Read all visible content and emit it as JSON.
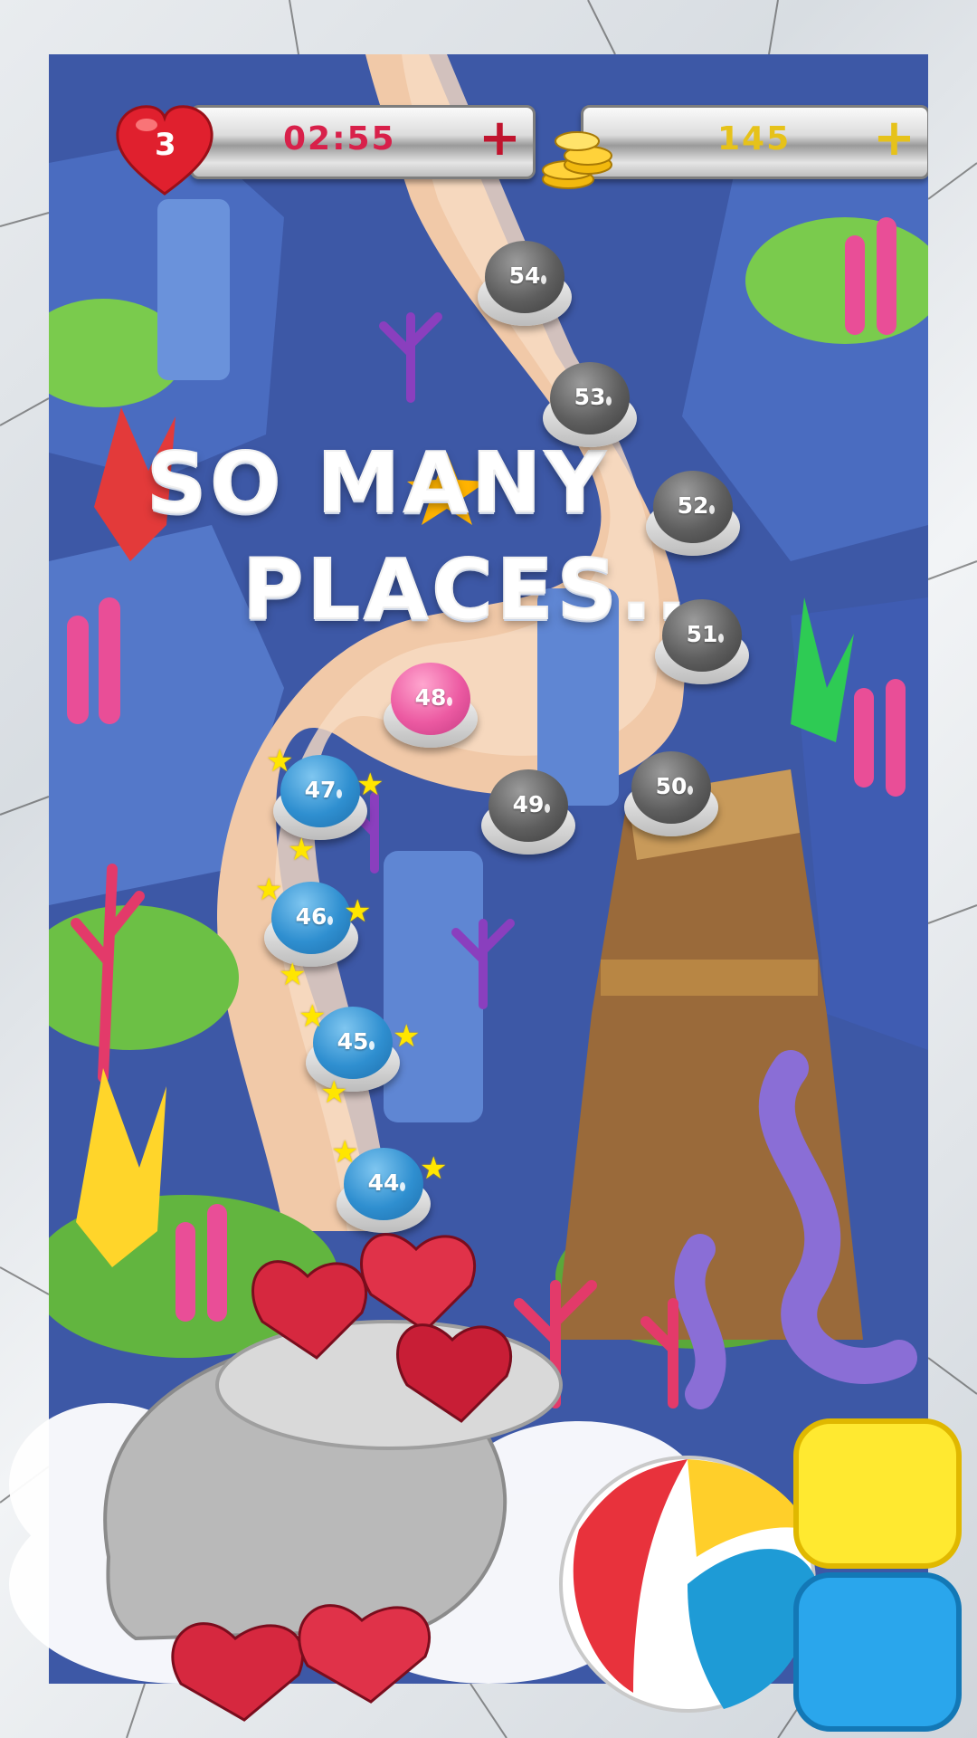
{
  "hud": {
    "lives_count": "3",
    "timer": "02:55",
    "timer_plus": "+",
    "coins": "145",
    "coins_plus": "+"
  },
  "title": {
    "line1": "SO MANY",
    "line2": "PLACES..."
  },
  "levels": [
    {
      "number": "54",
      "state": "locked"
    },
    {
      "number": "53",
      "state": "locked"
    },
    {
      "number": "52",
      "state": "locked"
    },
    {
      "number": "51",
      "state": "locked"
    },
    {
      "number": "50",
      "state": "locked"
    },
    {
      "number": "49",
      "state": "locked"
    },
    {
      "number": "48",
      "state": "current"
    },
    {
      "number": "47",
      "state": "completed"
    },
    {
      "number": "46",
      "state": "completed"
    },
    {
      "number": "45",
      "state": "completed"
    },
    {
      "number": "44",
      "state": "completed"
    }
  ],
  "colors": {
    "timer_text": "#d8204a",
    "coins_text": "#e6c21a",
    "locked": "#5e5e5e",
    "completed": "#2f8fd0",
    "current": "#ec5aa2",
    "star": "#ffe600"
  }
}
